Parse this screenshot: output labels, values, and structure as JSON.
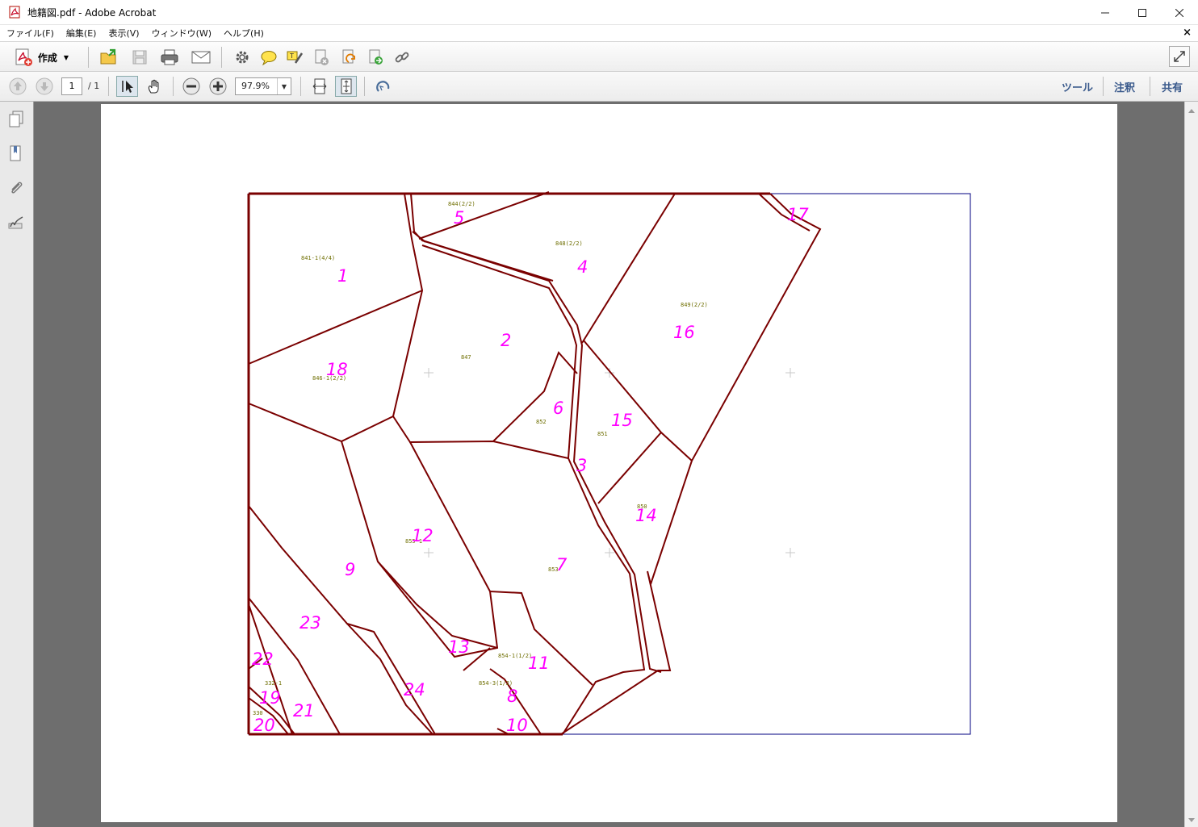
{
  "window": {
    "title": "地籍図.pdf - Adobe Acrobat"
  },
  "menu": {
    "items": [
      "ファイル(F)",
      "編集(E)",
      "表示(V)",
      "ウィンドウ(W)",
      "ヘルプ(H)"
    ],
    "close_glyph": "×"
  },
  "toolbar": {
    "create_label": "作成"
  },
  "nav": {
    "current_page": "1",
    "total_pages": "/ 1",
    "zoom": "97.9%"
  },
  "panels": {
    "tools": "ツール",
    "comment": "注釈",
    "share": "共有"
  },
  "colors": {
    "boundary": "#7a0000",
    "parcel_number": "#ff00ff",
    "lot_label": "#6e6e00",
    "frame": "#000080"
  },
  "map": {
    "parcels": [
      {
        "n": "1"
      },
      {
        "n": "2"
      },
      {
        "n": "3"
      },
      {
        "n": "4"
      },
      {
        "n": "5"
      },
      {
        "n": "6"
      },
      {
        "n": "7"
      },
      {
        "n": "8"
      },
      {
        "n": "9"
      },
      {
        "n": "10"
      },
      {
        "n": "11"
      },
      {
        "n": "12"
      },
      {
        "n": "13"
      },
      {
        "n": "14"
      },
      {
        "n": "15"
      },
      {
        "n": "16"
      },
      {
        "n": "17"
      },
      {
        "n": "18"
      },
      {
        "n": "19"
      },
      {
        "n": "20"
      },
      {
        "n": "21"
      },
      {
        "n": "22"
      },
      {
        "n": "23"
      },
      {
        "n": "24"
      }
    ],
    "lot_labels": [
      {
        "t": "844(2/2)"
      },
      {
        "t": "841-1(4/4)"
      },
      {
        "t": "848(2/2)"
      },
      {
        "t": "849(2/2)"
      },
      {
        "t": "847"
      },
      {
        "t": "846-1(2/2)"
      },
      {
        "t": "852"
      },
      {
        "t": "851"
      },
      {
        "t": "850"
      },
      {
        "t": "853"
      },
      {
        "t": "855-1"
      },
      {
        "t": "854-1(1/2)"
      },
      {
        "t": "854-3(1/2)"
      },
      {
        "t": "332-1"
      },
      {
        "t": "330"
      }
    ]
  }
}
